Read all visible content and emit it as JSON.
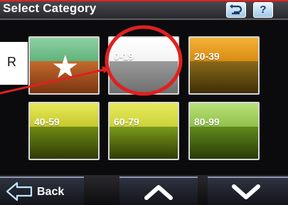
{
  "header": {
    "title": "Select Category",
    "undo_icon": "undo-icon",
    "help_label": "?"
  },
  "tiles": [
    {
      "label": "",
      "icon": "star-icon"
    },
    {
      "label": "0-19"
    },
    {
      "label": "20-39"
    },
    {
      "label": "40-59"
    },
    {
      "label": "60-79"
    },
    {
      "label": "80-99"
    }
  ],
  "footer": {
    "back_label": "Back",
    "back_icon": "back-arrow-icon",
    "up_icon": "chevron-up-icon",
    "down_icon": "chevron-down-icon"
  },
  "annotation": {
    "callout_text": "R",
    "highlight_color": "#e02020"
  }
}
